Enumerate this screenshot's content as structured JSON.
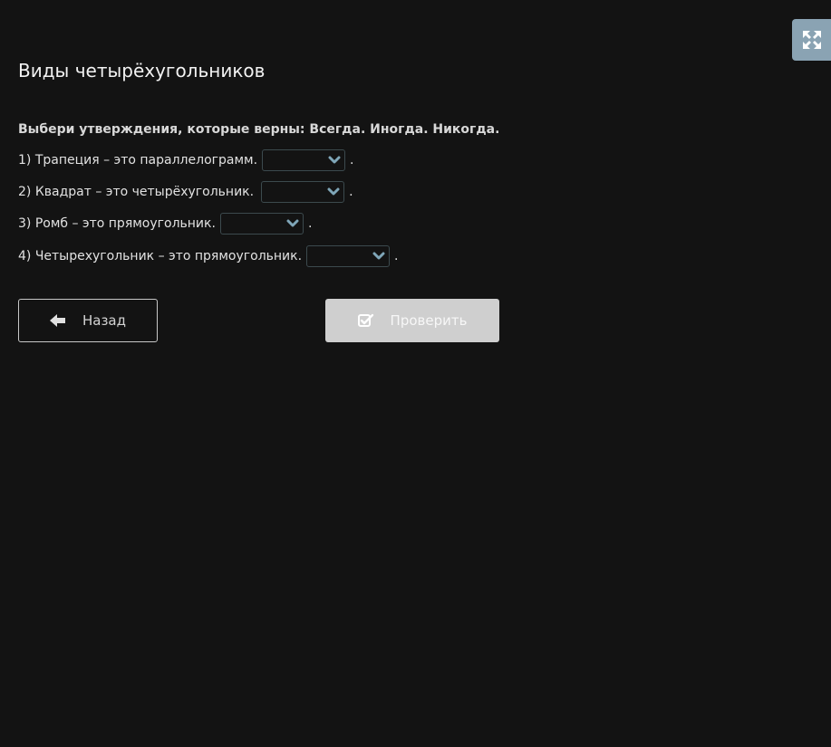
{
  "header": {
    "title": "Виды четырёхугольников",
    "fullscreen_icon": "expand-arrows-icon"
  },
  "task": {
    "instruction": "Выбери утверждения, которые верны: Всегда. Иногда. Никогда.",
    "questions": [
      {
        "text": "1) Трапеция – это параллелограмм.",
        "selected": "",
        "suffix": "."
      },
      {
        "text": "2) Квадрат – это четырёхугольник.",
        "selected": "",
        "suffix": "."
      },
      {
        "text": "3) Ромб – это прямоугольник.",
        "selected": "",
        "suffix": "."
      },
      {
        "text": "4) Четырехугольник – это прямоугольник.",
        "selected": "",
        "suffix": "."
      }
    ]
  },
  "actions": {
    "back_label": "Назад",
    "check_label": "Проверить",
    "back_icon": "arrow-left-icon",
    "check_icon": "checkbox-checked-icon"
  },
  "colors": {
    "background": "#131313",
    "fullscreen_button": "#8aa3b3",
    "dropdown_chevron": "#7fa6b8",
    "check_button_disabled": "#cfcfcf"
  }
}
